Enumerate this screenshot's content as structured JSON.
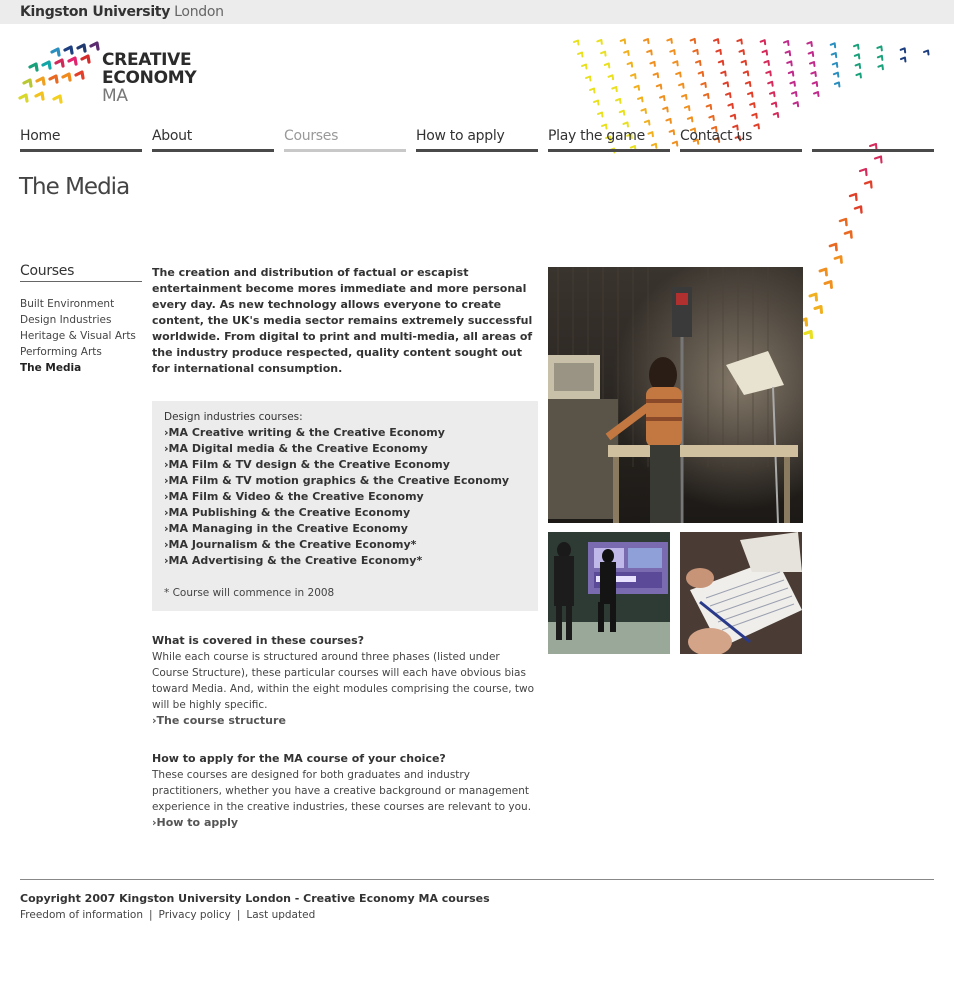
{
  "header": {
    "university_bold": "Kingston University",
    "university_light": " London"
  },
  "logo": {
    "line1": "CREATIVE",
    "line2": "ECONOMY",
    "line3": "MA"
  },
  "nav": {
    "items": [
      {
        "label": "Home"
      },
      {
        "label": "About"
      },
      {
        "label": "Courses"
      },
      {
        "label": "How to apply"
      },
      {
        "label": "Play the game"
      },
      {
        "label": "Contact us"
      },
      {
        "label": ""
      }
    ]
  },
  "page": {
    "title": "The Media"
  },
  "sidebar": {
    "heading": "Courses",
    "items": [
      {
        "label": "Built Environment"
      },
      {
        "label": "Design Industries"
      },
      {
        "label": "Heritage & Visual Arts"
      },
      {
        "label": "Performing Arts"
      },
      {
        "label": "The Media"
      }
    ]
  },
  "main": {
    "intro": "The creation and distribution of factual or escapist entertainment become mores immediate and more personal every day. As new technology allows everyone to create content, the UK's media sector remains extremely successful worldwide. From digital to print and multi-media, all areas of the industry produce respected, quality content sought out for international consumption.",
    "box_heading": "Design industries courses:",
    "chevron": "›",
    "courses": [
      {
        "label": "MA Creative writing & the Creative Economy"
      },
      {
        "label": "MA Digital media & the Creative Economy"
      },
      {
        "label": "MA Film & TV design & the Creative Economy"
      },
      {
        "label": "MA Film & TV motion graphics & the Creative Economy"
      },
      {
        "label": "MA Film & Video & the Creative Economy"
      },
      {
        "label": "MA Publishing & the Creative Economy"
      },
      {
        "label": "MA Managing in the Creative Economy"
      },
      {
        "label": "MA Journalism & the Creative Economy*"
      },
      {
        "label": "MA Advertising & the Creative Economy*"
      }
    ],
    "note": "* Course will commence in 2008",
    "sections": [
      {
        "heading": "What is covered in these courses?",
        "body": "While each course is structured around three phases (listed under Course Structure), these particular courses will each have obvious bias toward Media. And, within the eight modules comprising the course, two will be highly specific.",
        "link": "The course structure"
      },
      {
        "heading": "How to apply for the MA course of your choice?",
        "body": "These courses are designed for both graduates and industry practitioners, whether you have a creative background or management experience in the creative industries, these courses are relevant to you.",
        "link": "How to apply"
      }
    ]
  },
  "footer": {
    "copyright": "Copyright 2007 Kingston University London  -  Creative Economy MA courses",
    "links": [
      {
        "label": "Freedom of information"
      },
      {
        "label": "Privacy policy"
      },
      {
        "label": "Last updated"
      }
    ],
    "separator": "|"
  },
  "colors": {
    "nav_underline": "#4a4a4a",
    "nav_current": "#999999",
    "box_bg": "#ececec",
    "topbar_bg": "#ececec"
  }
}
